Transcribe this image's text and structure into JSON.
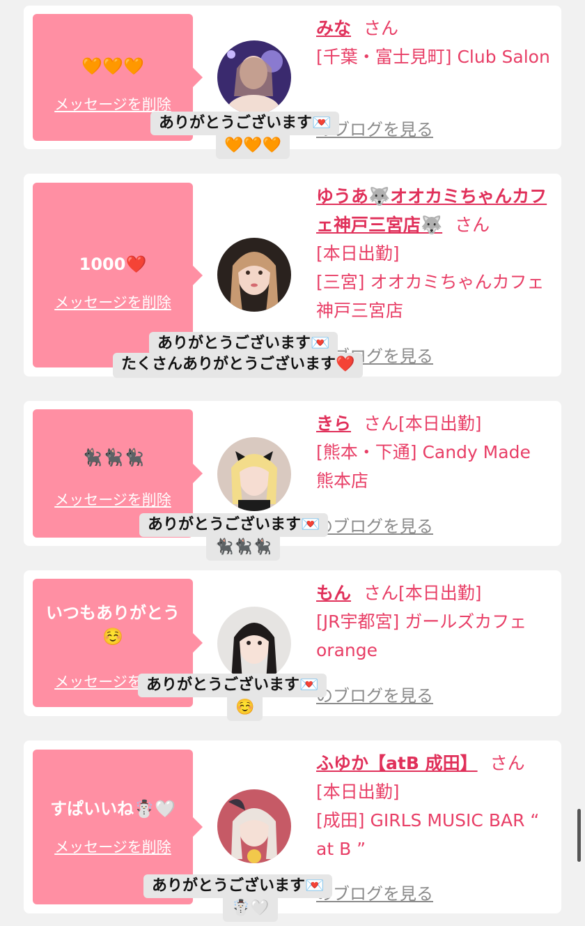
{
  "common": {
    "delete_label": "メッセージを削除",
    "blog_label": "のブログを見る",
    "san": "さん"
  },
  "items": [
    {
      "message": "🧡🧡🧡",
      "name": "みな",
      "info_lines": [
        "[千葉・富士見町] Club Salon"
      ],
      "reply": "ありがとうございます💌",
      "reply_extra": "🧡🧡🧡"
    },
    {
      "message": "1000❤️",
      "name": "ゆうあ🐺オオカミちゃんカフェ神戸三宮店🐺",
      "info_lines": [
        "[本日出勤]",
        "[三宮] オオカミちゃんカフェ神戸三宮店"
      ],
      "reply": "ありがとうございます💌",
      "reply_extra": "たくさんありがとうございます❤️"
    },
    {
      "message": "🐈‍⬛🐈‍⬛🐈‍⬛",
      "name": "きら",
      "status": "[本日出勤]",
      "info_lines": [
        "[熊本・下通] Candy Made 熊本店"
      ],
      "reply": "ありがとうございます💌",
      "reply_extra": "🐈‍⬛🐈‍⬛🐈‍⬛"
    },
    {
      "message": "いつもありがとう☺️",
      "name": "もん",
      "status": "[本日出勤]",
      "info_lines": [
        "[JR宇都宮] ガールズカフェ orange"
      ],
      "reply": "ありがとうございます💌",
      "reply_extra": "☺️"
    },
    {
      "message": "すぱいいね☃️🤍",
      "name": "ふゆか【atB 成田】",
      "info_lines": [
        "[本日出勤]",
        "[成田] GIRLS MUSIC BAR “ at B ”"
      ],
      "reply": "ありがとうございます💌",
      "reply_extra": "☃️🤍"
    }
  ]
}
